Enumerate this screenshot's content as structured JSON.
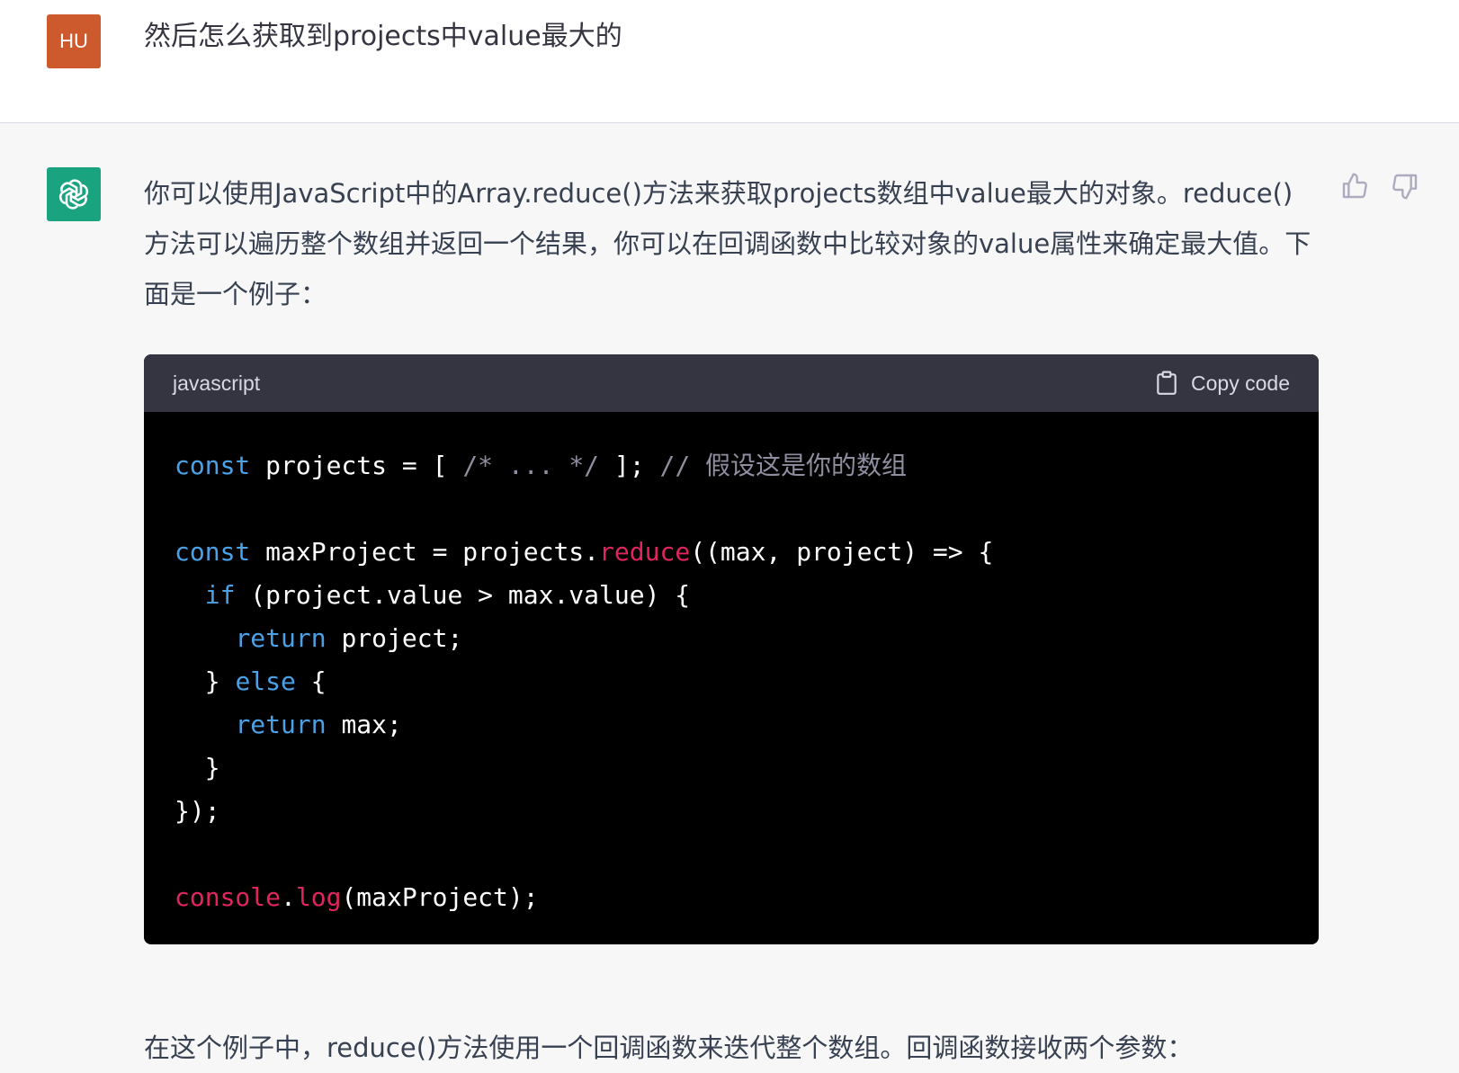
{
  "user": {
    "avatar_initials": "HU",
    "avatar_color": "#cc5a2c",
    "message": "然后怎么获取到projects中value最大的"
  },
  "assistant": {
    "avatar_icon": "openai-logo-icon",
    "avatar_color": "#19a37f",
    "intro": "你可以使用JavaScript中的Array.reduce()方法来获取projects数组中value最大的对象。reduce()方法可以遍历整个数组并返回一个结果，你可以在回调函数中比较对象的value属性来确定最大值。下面是一个例子：",
    "outro": "在这个例子中，reduce()方法使用一个回调函数来迭代整个数组。回调函数接收两个参数：",
    "feedback": {
      "thumbs_up_icon": "thumbs-up-icon",
      "thumbs_down_icon": "thumbs-down-icon"
    }
  },
  "code_block": {
    "language": "javascript",
    "copy_label": "Copy code",
    "copy_icon": "clipboard-icon",
    "lines": [
      [
        {
          "t": "kw",
          "v": "const"
        },
        {
          "t": "pl",
          "v": " projects = [ "
        },
        {
          "t": "cm",
          "v": "/* ... */"
        },
        {
          "t": "pl",
          "v": " ]; "
        },
        {
          "t": "cm",
          "v": "// 假设这是你的数组"
        }
      ],
      [],
      [
        {
          "t": "kw",
          "v": "const"
        },
        {
          "t": "pl",
          "v": " maxProject = projects."
        },
        {
          "t": "fn",
          "v": "reduce"
        },
        {
          "t": "pl",
          "v": "((max, project) => {"
        }
      ],
      [
        {
          "t": "pl",
          "v": "  "
        },
        {
          "t": "kw",
          "v": "if"
        },
        {
          "t": "pl",
          "v": " (project.value > max.value) {"
        }
      ],
      [
        {
          "t": "pl",
          "v": "    "
        },
        {
          "t": "kw",
          "v": "return"
        },
        {
          "t": "pl",
          "v": " project;"
        }
      ],
      [
        {
          "t": "pl",
          "v": "  } "
        },
        {
          "t": "kw",
          "v": "else"
        },
        {
          "t": "pl",
          "v": " {"
        }
      ],
      [
        {
          "t": "pl",
          "v": "    "
        },
        {
          "t": "kw",
          "v": "return"
        },
        {
          "t": "pl",
          "v": " max;"
        }
      ],
      [
        {
          "t": "pl",
          "v": "  }"
        }
      ],
      [
        {
          "t": "pl",
          "v": "});"
        }
      ],
      [],
      [
        {
          "t": "fn",
          "v": "console"
        },
        {
          "t": "pl",
          "v": "."
        },
        {
          "t": "fn",
          "v": "log"
        },
        {
          "t": "pl",
          "v": "(maxProject);"
        }
      ]
    ]
  }
}
